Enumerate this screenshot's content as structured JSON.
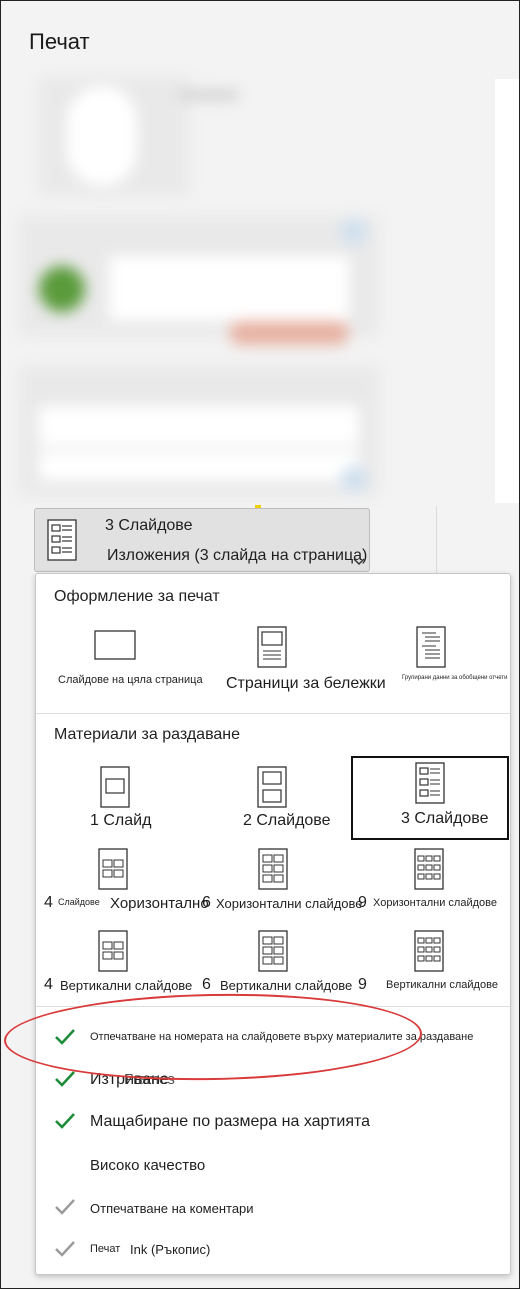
{
  "window": {
    "title": "Печат"
  },
  "layout_dropdown": {
    "line1": "3 Слайдове",
    "line2": "Изложения (3 слайда на страница)",
    "icon": "three-slides-handout-icon"
  },
  "menu": {
    "print_layout_heading": "Оформление за печат",
    "print_layout_options": [
      {
        "label": "Слайдове на цяла страница",
        "icon": "full-page-slide-icon"
      },
      {
        "label": "Страници за бележки",
        "icon": "notes-page-icon"
      },
      {
        "label": "Групирани данни за обобщени отчети",
        "icon": "outline-icon"
      }
    ],
    "handouts_heading": "Материали за раздаване",
    "handout_options": [
      {
        "label": "1 Слайд",
        "icon": "one-slide-icon"
      },
      {
        "label": "2 Слайдове",
        "icon": "two-slides-icon"
      },
      {
        "label": "3 Слайдове",
        "icon": "three-slides-icon",
        "selected": true
      },
      {
        "num": "4",
        "label_small": "Слайдове",
        "label": "Хоризонтално",
        "icon": "four-slides-horizontal-icon"
      },
      {
        "num": "6",
        "label": "Хоризонтални слайдове",
        "icon": "six-slides-horizontal-icon"
      },
      {
        "num": "9",
        "label": "Хоризонтални слайдове",
        "icon": "nine-slides-horizontal-icon"
      },
      {
        "num": "4",
        "label": "Вертикални слайдове",
        "icon": "four-slides-vertical-icon"
      },
      {
        "num": "6",
        "label": "Вертикални слайдове",
        "icon": "six-slides-vertical-icon"
      },
      {
        "num": "9",
        "label": "Вертикални слайдове",
        "icon": "nine-slides-vertical-icon"
      }
    ],
    "toggles": [
      {
        "label": "Отпечатване на номерата на слайдовете върху материалите за раздаване",
        "checked": true,
        "check_color": "#1e8c3a"
      },
      {
        "label": "Изтриване",
        "overlap": "Frames",
        "checked": true,
        "check_color": "#1e8c3a"
      },
      {
        "label": "Мащабиране по размера на хартията",
        "checked": true,
        "check_color": "#1e8c3a"
      },
      {
        "label": "Високо качество",
        "checked": false
      },
      {
        "label": "Отпечатване на коментари",
        "checked": true,
        "check_color": "#9a9a9a"
      },
      {
        "label_small": "Печат",
        "label": "Ink (Ръкопис)",
        "checked": true,
        "check_color": "#9a9a9a"
      }
    ]
  },
  "annotation": {
    "color": "#d93a3a",
    "shape": "ellipse"
  }
}
